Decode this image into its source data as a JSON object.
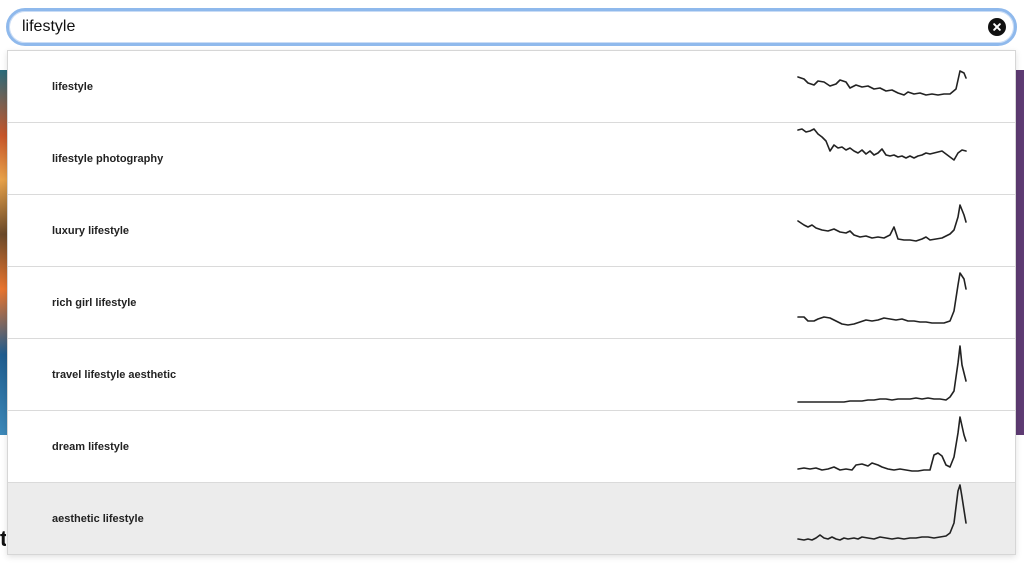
{
  "search": {
    "value": "lifestyle"
  },
  "suggestions": [
    {
      "label": "lifestyle"
    },
    {
      "label": "lifestyle photography"
    },
    {
      "label": "luxury lifestyle"
    },
    {
      "label": "rich girl lifestyle"
    },
    {
      "label": "travel lifestyle aesthetic"
    },
    {
      "label": "dream lifestyle"
    },
    {
      "label": "aesthetic lifestyle",
      "selected": true
    }
  ],
  "colors": {
    "focus_ring": "#8fb9ec",
    "selected_row": "#ececec",
    "trend_line": "#222222"
  },
  "icons": {
    "clear": "close-circle-icon"
  }
}
